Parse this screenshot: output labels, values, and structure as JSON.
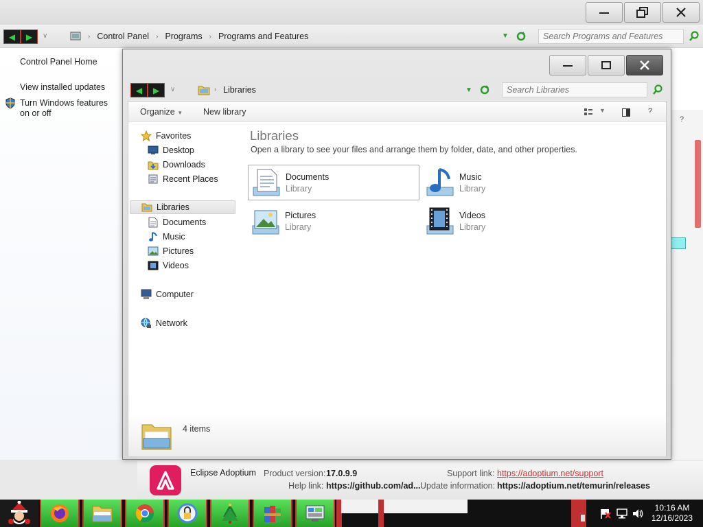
{
  "background_window": {
    "breadcrumbs": [
      "Control Panel",
      "Programs",
      "Programs and Features"
    ],
    "search_placeholder": "Search Programs and Features",
    "side_links": [
      "Control Panel Home",
      "View installed updates",
      "Turn Windows features on or off"
    ],
    "help_glyph": "?"
  },
  "details": {
    "app_name": "Eclipse Adoptium",
    "product_version_label": "Product version:",
    "product_version": "17.0.9.9",
    "support_link_label": "Support link:",
    "support_link": "https://adoptium.net/support",
    "help_link_label": "Help link:",
    "help_link": "https://github.com/ad...",
    "update_info_label": "Update information:",
    "update_info": "https://adoptium.net/temurin/releases"
  },
  "libraries_window": {
    "location": "Libraries",
    "search_placeholder": "Search Libraries",
    "toolbar": {
      "organize": "Organize",
      "new_library": "New library",
      "help": "?"
    },
    "nav": {
      "favorites": "Favorites",
      "favorites_items": [
        "Desktop",
        "Downloads",
        "Recent Places"
      ],
      "libraries": "Libraries",
      "libraries_items": [
        "Documents",
        "Music",
        "Pictures",
        "Videos"
      ],
      "computer": "Computer",
      "network": "Network"
    },
    "title": "Libraries",
    "description": "Open a library to see your files and arrange them by folder, date, and other properties.",
    "tiles": [
      {
        "name": "Documents",
        "type": "Library"
      },
      {
        "name": "Music",
        "type": "Library"
      },
      {
        "name": "Pictures",
        "type": "Library"
      },
      {
        "name": "Videos",
        "type": "Library"
      }
    ],
    "status": "4 items"
  },
  "taskbar": {
    "time": "10:16 AM",
    "date": "12/16/2023"
  },
  "colors": {
    "accent_green": "#28a228",
    "taskbar_border_red": "#d03030",
    "link_red": "#d0302e",
    "adoptium_pink": "#e01d5f"
  }
}
